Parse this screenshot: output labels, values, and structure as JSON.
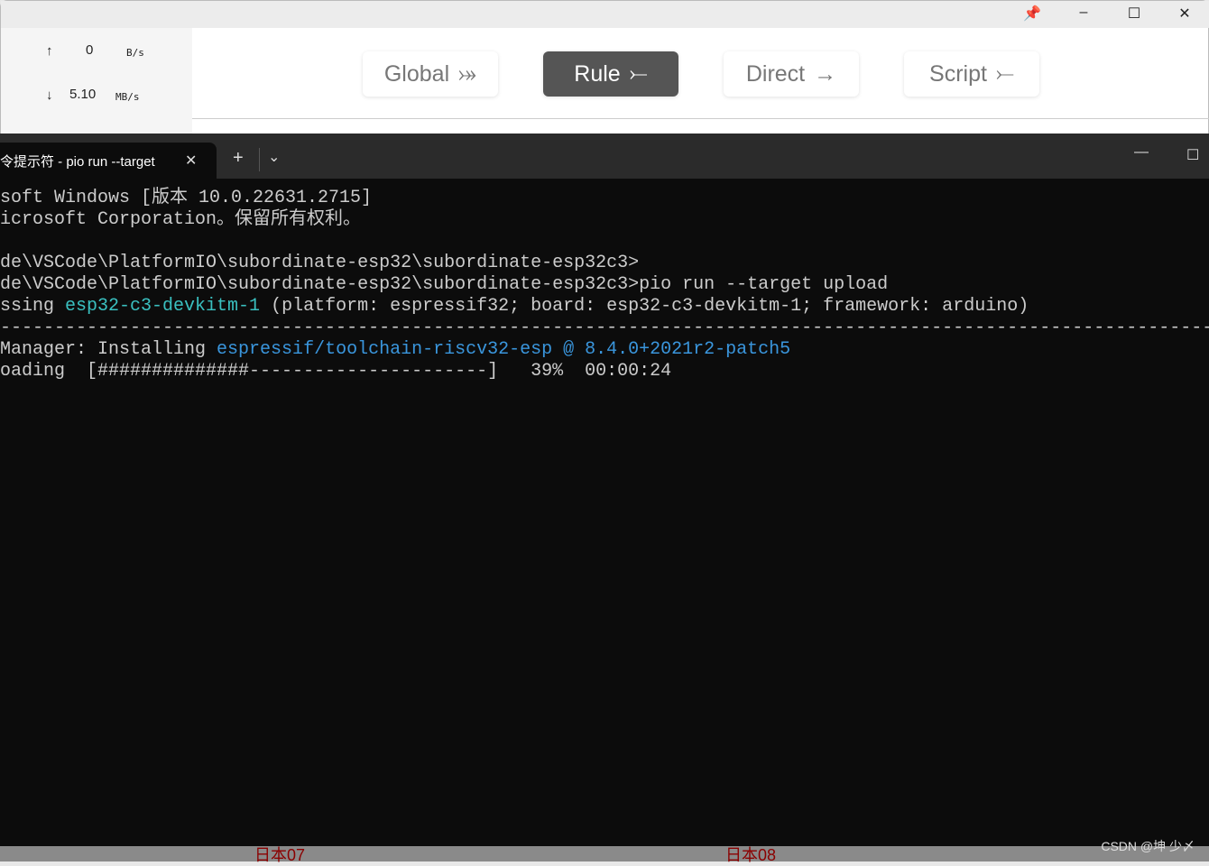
{
  "bg_app": {
    "window_controls": {
      "pin": "pin-icon",
      "minimize": "–",
      "maximize": "☐",
      "close": "✕"
    },
    "speed": {
      "up_arrow": "↑",
      "up_value": "0",
      "up_unit": "B/s",
      "down_arrow": "↓",
      "down_value": "5.10",
      "down_unit": "MB/s"
    },
    "modes": [
      {
        "label": "Global",
        "icon": "⤖",
        "active": false
      },
      {
        "label": "Rule",
        "icon": "⤚",
        "active": true
      },
      {
        "label": "Direct",
        "icon": "→",
        "active": false
      },
      {
        "label": "Script",
        "icon": "⤚",
        "active": false
      }
    ],
    "bottom_items": [
      "日本07",
      "日本08"
    ]
  },
  "terminal": {
    "tab_title": "令提示符 - pio  run --target",
    "new_tab": "+",
    "dropdown": "⌄",
    "minimize": "—",
    "maximize": "☐",
    "lines": {
      "l1": "soft Windows [版本 10.0.22631.2715]",
      "l2": "icrosoft Corporation。保留所有权利。",
      "l3": "",
      "l4": "de\\VSCode\\PlatformIO\\subordinate-esp32\\subordinate-esp32c3>",
      "l5": "de\\VSCode\\PlatformIO\\subordinate-esp32\\subordinate-esp32c3>pio run --target upload",
      "l6a": "ssing ",
      "l6b": "esp32-c3-devkitm-1",
      "l6c": " (platform: espressif32; board: esp32-c3-devkitm-1; framework: arduino)",
      "l7": "------------------------------------------------------------------------------------------------------------------",
      "l8a": "Manager: Installing ",
      "l8b": "espressif/toolchain-riscv32-esp @ 8.4.0+2021r2-patch5",
      "l9": "oading  [##############----------------------]   39%  00:00:24"
    },
    "progress_percent": 39,
    "colors": {
      "background": "#0c0c0c",
      "cyan": "#3ac0c0",
      "blue": "#3a96dd"
    }
  },
  "watermark": "CSDN @坤 少〆"
}
